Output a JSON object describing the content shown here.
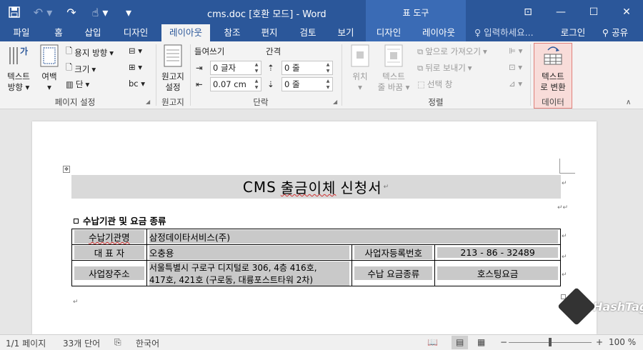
{
  "window": {
    "title": "cms.doc [호환 모드] - Word",
    "context_tab_title": "표 도구"
  },
  "tabs": [
    {
      "label": "파일"
    },
    {
      "label": "홈"
    },
    {
      "label": "삽입"
    },
    {
      "label": "디자인"
    },
    {
      "label": "레이아웃",
      "active": true
    },
    {
      "label": "참조"
    },
    {
      "label": "편지"
    },
    {
      "label": "검토"
    },
    {
      "label": "보기"
    },
    {
      "label": "디자인"
    },
    {
      "label": "레이아웃"
    }
  ],
  "tellme": "입력하세요...",
  "signin": "로그인",
  "share": "공유",
  "ribbon": {
    "page_setup": {
      "label": "페이지 설정",
      "text_direction": "텍스트\n방향",
      "text_direction_l1": "텍스트",
      "text_direction_l2": "방향",
      "margins": "여백",
      "orientation": "용지 방향",
      "size": "크기",
      "columns": "단"
    },
    "manuscript": {
      "label": "원고지",
      "btn_l1": "원고지",
      "btn_l2": "설정"
    },
    "paragraph": {
      "label": "단락",
      "indent_label": "들여쓰기",
      "spacing_label": "간격",
      "indent_left": "0 글자",
      "indent_right": "0.07 cm",
      "spacing_before": "0 줄",
      "spacing_after": "0 줄"
    },
    "arrange": {
      "label": "정렬",
      "position": "위치",
      "wrap_l1": "텍스트",
      "wrap_l2": "줄 바꿈",
      "bring_forward": "앞으로 가져오기",
      "send_backward": "뒤로 보내기",
      "selection_pane": "선택 창"
    },
    "data": {
      "label": "데이터",
      "convert_l1": "텍스트",
      "convert_l2": "로 변환"
    }
  },
  "document": {
    "title_prefix": "CMS ",
    "title_wavy": "출금이체",
    "title_suffix": " 신청서",
    "section_heading": "수납기관 및 요금 종류",
    "table": {
      "r1c1": "수납기관명",
      "r1c2": "삼정데이타서비스(주)",
      "r2c1": "대 표 자",
      "r2c2": "오충용",
      "r2c3": "사업자등록번호",
      "r2c4": "213 - 86 - 32489",
      "r3c1": "사업장주소",
      "r3c2_l1": "서울특별시 구로구 디지털로 306, 4층 416호,",
      "r3c2_l2": "417호, 421호 (구로동, 대륭포스트타워 2차)",
      "r3c3": "수납 요금종류",
      "r3c4": "호스팅요금"
    }
  },
  "status": {
    "page": "1/1 페이지",
    "words": "33개 단어",
    "language": "한국어",
    "zoom": "100 %"
  },
  "watermark": "HashTag",
  "colors": {
    "title_bar": "#2b579a",
    "context_tab": "#3a6bb5",
    "highlight": "#e0807a"
  }
}
